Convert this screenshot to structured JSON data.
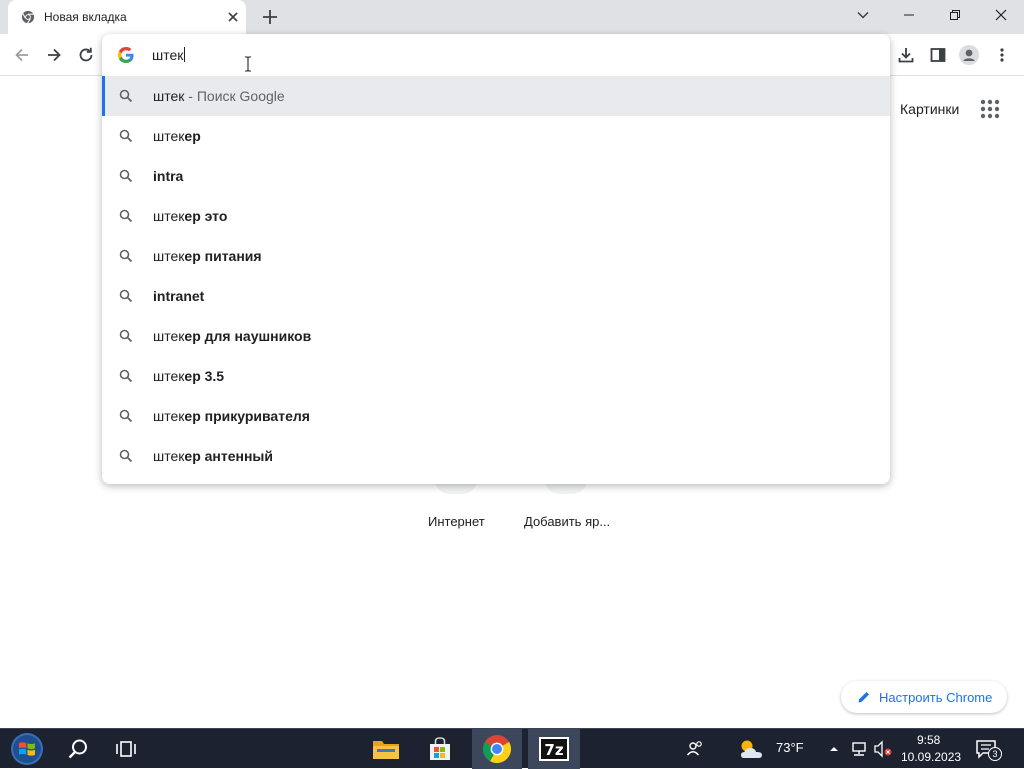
{
  "colors": {
    "accent": "#1a73e8",
    "selected_row": "#e8eaed",
    "taskbar": "#1c2230",
    "tab_strip": "#dfe1e5"
  },
  "tab": {
    "title": "Новая вкладка",
    "favicon": "chrome-icon"
  },
  "toolbar": {
    "back": "back-icon",
    "forward": "forward-icon",
    "reload": "reload-icon"
  },
  "omnibox": {
    "value": "штек",
    "suggestions": [
      {
        "typed": "штек",
        "rest": "",
        "suffix": " - Поиск Google",
        "selected": true
      },
      {
        "typed": "штек",
        "rest": "ер",
        "suffix": ""
      },
      {
        "typed": "",
        "rest": "intra",
        "suffix": ""
      },
      {
        "typed": "штек",
        "rest": "ер это",
        "suffix": ""
      },
      {
        "typed": "штек",
        "rest": "ер питания",
        "suffix": ""
      },
      {
        "typed": "",
        "rest": "intranet",
        "suffix": ""
      },
      {
        "typed": "штек",
        "rest": "ер для наушников",
        "suffix": ""
      },
      {
        "typed": "штек",
        "rest": "ер 3.5",
        "suffix": ""
      },
      {
        "typed": "штек",
        "rest": "ер прикуривателя",
        "suffix": ""
      },
      {
        "typed": "штек",
        "rest": "ер антенный",
        "suffix": ""
      }
    ]
  },
  "page": {
    "images_link": "Картинки",
    "shortcuts": [
      {
        "label": "Интернет"
      },
      {
        "label": "Добавить яр..."
      }
    ],
    "customize_label": "Настроить Chrome"
  },
  "taskbar": {
    "weather_temp": "73°F",
    "time": "9:58",
    "date": "10.09.2023",
    "notification_count": "3"
  }
}
